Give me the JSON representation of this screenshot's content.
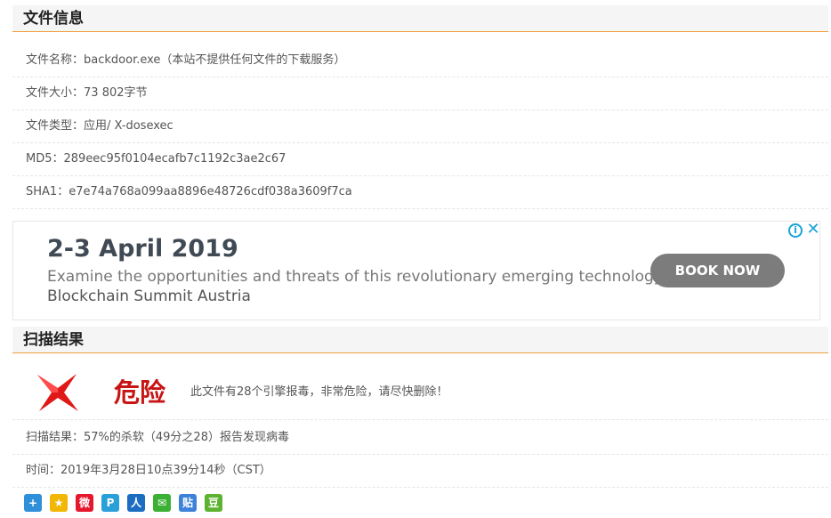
{
  "file_info": {
    "title": "文件信息",
    "rows": [
      {
        "label": "文件名称：",
        "value": "backdoor.exe（本站不提供任何文件的下载服务）"
      },
      {
        "label": "文件大小：",
        "value": "73 802字节"
      },
      {
        "label": "文件类型：",
        "value": "应用/ X-dosexec"
      },
      {
        "label": "MD5：",
        "value": "289eec95f0104ecafb7c1192c3ae2c67"
      },
      {
        "label": "SHA1：",
        "value": "e7e74a768a099aa8896e48726cdf038a3609f7ca"
      }
    ]
  },
  "ad": {
    "date": "2-3 April 2019",
    "description": "Examine the opportunities and threats of this revolutionary emerging technology.",
    "brand": "Blockchain Summit Austria",
    "button": "BOOK NOW",
    "info_icon": "info-icon",
    "close_icon": "close-icon",
    "accent": "#1aa3d8"
  },
  "scan": {
    "title": "扫描结果",
    "danger_label": "危险",
    "danger_desc": "此文件有28个引擎报毒，非常危险，请尽快删除！",
    "danger_icon": "red-x-icon",
    "result": "扫描结果：57%的杀软（49分之28）报告发现病毒",
    "time": "时间：2019年3月28日10点39分14秒（CST）"
  },
  "share_icons": [
    {
      "name": "share-more-icon",
      "glyph": "+",
      "color": "#2f8fd8"
    },
    {
      "name": "qzone-icon",
      "glyph": "★",
      "color": "#f2b705"
    },
    {
      "name": "weibo-icon",
      "glyph": "微",
      "color": "#e6162d"
    },
    {
      "name": "tencent-weibo-icon",
      "glyph": "P",
      "color": "#2aa0d8"
    },
    {
      "name": "renren-icon",
      "glyph": "人",
      "color": "#1c6dc2"
    },
    {
      "name": "wechat-icon",
      "glyph": "✉",
      "color": "#3cb034"
    },
    {
      "name": "tieba-icon",
      "glyph": "贴",
      "color": "#3d82d8"
    },
    {
      "name": "douban-icon",
      "glyph": "豆",
      "color": "#5db330"
    }
  ]
}
